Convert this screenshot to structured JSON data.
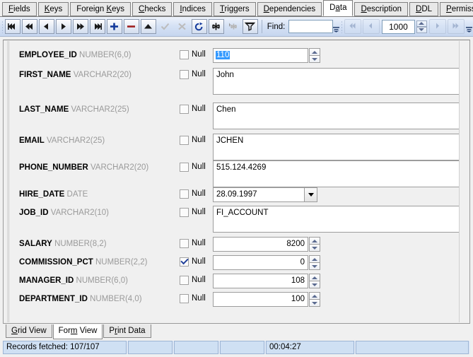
{
  "top_tabs": [
    {
      "label": "Fields",
      "mnemonic": "F",
      "active": false
    },
    {
      "label": "Keys",
      "mnemonic": "K",
      "active": false
    },
    {
      "label": "Foreign Keys",
      "mnemonic": "K",
      "active": false
    },
    {
      "label": "Checks",
      "mnemonic": "C",
      "active": false
    },
    {
      "label": "Indices",
      "mnemonic": "I",
      "active": false
    },
    {
      "label": "Triggers",
      "mnemonic": "T",
      "active": false
    },
    {
      "label": "Dependencies",
      "mnemonic": "D",
      "active": false
    },
    {
      "label": "Data",
      "mnemonic": "a",
      "active": true
    },
    {
      "label": "Description",
      "mnemonic": "D",
      "active": false
    },
    {
      "label": "DDL",
      "mnemonic": "D",
      "active": false
    },
    {
      "label": "Permissions",
      "mnemonic": "P",
      "active": false
    }
  ],
  "toolbar": {
    "buttons": [
      {
        "name": "first-record-button",
        "icon": "first",
        "enabled": true
      },
      {
        "name": "fast-backward-button",
        "icon": "fastback",
        "enabled": true
      },
      {
        "name": "previous-record-button",
        "icon": "back",
        "enabled": true
      },
      {
        "name": "next-record-button",
        "icon": "forward",
        "enabled": true
      },
      {
        "name": "fast-forward-button",
        "icon": "fastforward",
        "enabled": true
      },
      {
        "name": "last-record-button",
        "icon": "last",
        "enabled": true
      },
      {
        "name": "insert-record-button",
        "icon": "plus",
        "enabled": true
      },
      {
        "name": "delete-record-button",
        "icon": "minus",
        "enabled": true
      },
      {
        "name": "edit-record-button",
        "icon": "caret-up",
        "enabled": true
      },
      {
        "name": "post-edit-button",
        "icon": "check",
        "enabled": false
      },
      {
        "name": "cancel-edit-button",
        "icon": "cross",
        "enabled": false
      },
      {
        "name": "refresh-button",
        "icon": "refresh",
        "enabled": true
      },
      {
        "name": "set-null-button",
        "icon": "asterisk",
        "enabled": true
      },
      {
        "name": "clear-null-button",
        "icon": "asterisk-dim",
        "enabled": false
      },
      {
        "name": "filter-button",
        "icon": "funnel",
        "enabled": true
      }
    ],
    "find_label": "Find:",
    "find_value": "",
    "find_placeholder": "",
    "page_value": "1000",
    "nav_buttons": [
      {
        "name": "first-page-button",
        "icon": "double-left"
      },
      {
        "name": "prev-page-button",
        "icon": "single-left"
      },
      {
        "name": "next-page-button",
        "icon": "single-right"
      },
      {
        "name": "last-page-button",
        "icon": "double-right"
      }
    ]
  },
  "form": {
    "fields": [
      {
        "name": "EMPLOYEE_ID",
        "type": "NUMBER(6,0)",
        "null_checked": false,
        "value": "110",
        "control": "number",
        "selected": true
      },
      {
        "name": "FIRST_NAME",
        "type": "VARCHAR2(20)",
        "null_checked": false,
        "value": "John",
        "control": "textarea",
        "selected": false
      },
      {
        "name": "LAST_NAME",
        "type": "VARCHAR2(25)",
        "null_checked": false,
        "value": "Chen",
        "control": "textarea",
        "selected": false
      },
      {
        "name": "EMAIL",
        "type": "VARCHAR2(25)",
        "null_checked": false,
        "value": "JCHEN",
        "control": "textarea",
        "selected": false
      },
      {
        "name": "PHONE_NUMBER",
        "type": "VARCHAR2(20)",
        "null_checked": false,
        "value": "515.124.4269",
        "control": "textarea",
        "selected": false
      },
      {
        "name": "HIRE_DATE",
        "type": "DATE",
        "null_checked": false,
        "value": "28.09.1997",
        "control": "date",
        "selected": false
      },
      {
        "name": "JOB_ID",
        "type": "VARCHAR2(10)",
        "null_checked": false,
        "value": "FI_ACCOUNT",
        "control": "textarea",
        "selected": false
      },
      {
        "name": "SALARY",
        "type": "NUMBER(8,2)",
        "null_checked": false,
        "value": "8200",
        "control": "number",
        "selected": false
      },
      {
        "name": "COMMISSION_PCT",
        "type": "NUMBER(2,2)",
        "null_checked": true,
        "value": "0",
        "control": "number",
        "selected": false
      },
      {
        "name": "MANAGER_ID",
        "type": "NUMBER(6,0)",
        "null_checked": false,
        "value": "108",
        "control": "number",
        "selected": false
      },
      {
        "name": "DEPARTMENT_ID",
        "type": "NUMBER(4,0)",
        "null_checked": false,
        "value": "100",
        "control": "number",
        "selected": false
      }
    ],
    "null_label": "Null"
  },
  "bottom_tabs": [
    {
      "label": "Grid View",
      "mnemonic": "G",
      "active": false
    },
    {
      "label": "Form View",
      "mnemonic": "m",
      "active": true
    },
    {
      "label": "Print Data",
      "mnemonic": "r",
      "active": false
    }
  ],
  "status": {
    "records_fetched": "Records fetched: 107/107",
    "panel2": "",
    "panel3": "",
    "panel4": "",
    "elapsed_time": "00:04:27",
    "panel6": ""
  }
}
